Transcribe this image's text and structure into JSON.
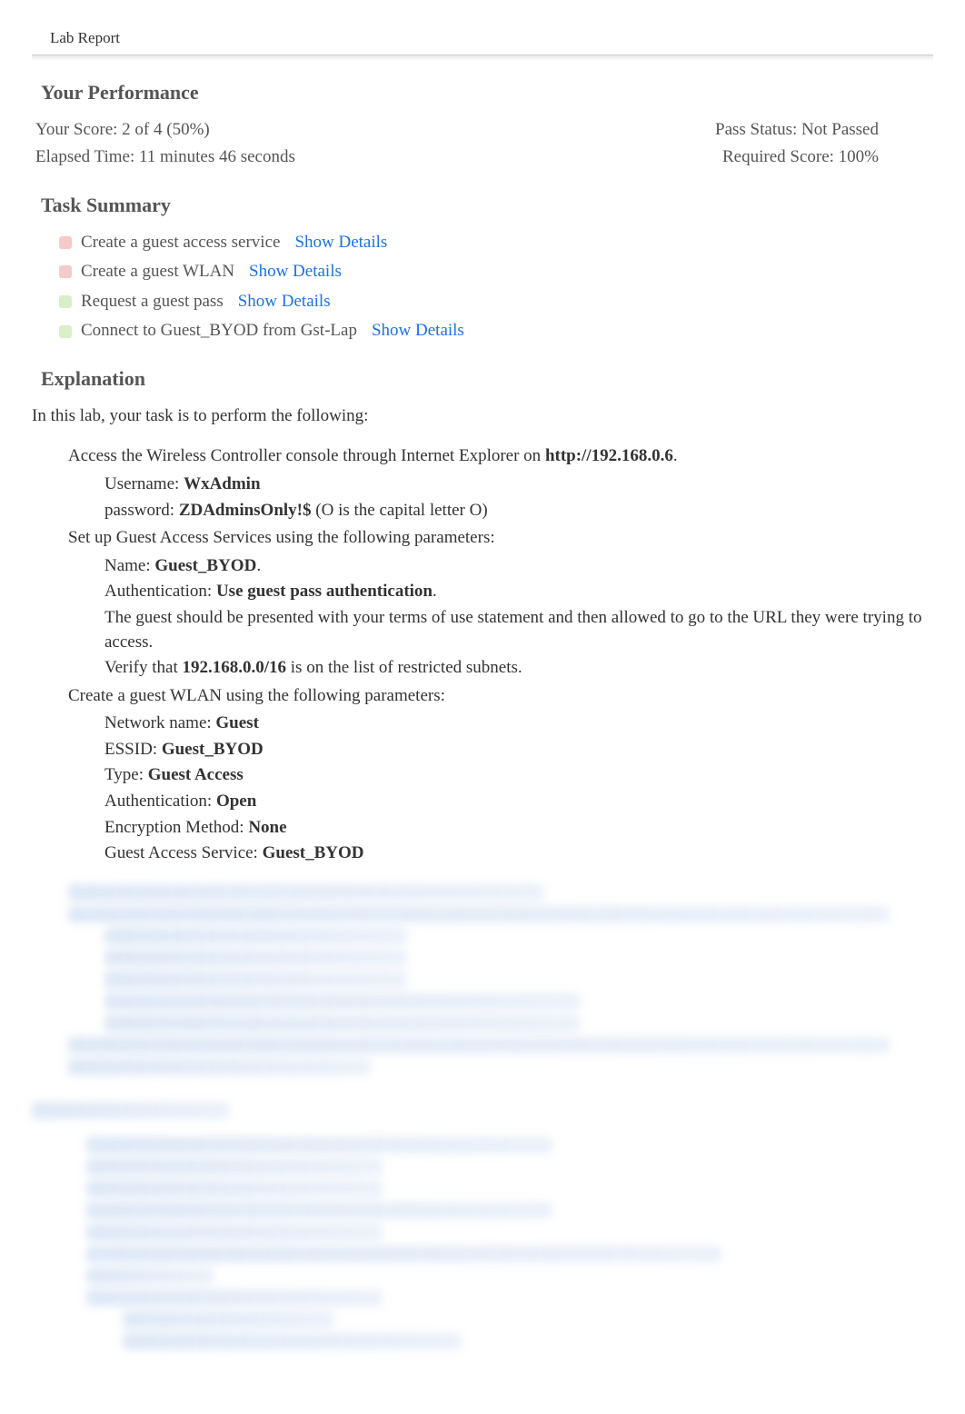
{
  "doc_title": "Lab Report",
  "performance": {
    "heading": "Your Performance",
    "score_label": "Your Score: 2 of 4 (50%)",
    "pass_status": "Pass Status: Not Passed",
    "elapsed_time": "Elapsed Time: 11 minutes 46 seconds",
    "required_score": "Required Score: 100%"
  },
  "task_summary": {
    "heading": "Task Summary",
    "show_details": "Show Details",
    "items": [
      {
        "label": "Create a guest access service",
        "status": "fail"
      },
      {
        "label": "Create a guest WLAN",
        "status": "fail"
      },
      {
        "label": "Request a guest pass",
        "status": "pass"
      },
      {
        "label": "Connect to Guest_BYOD from Gst-Lap",
        "status": "pass"
      }
    ]
  },
  "explanation": {
    "heading": "Explanation",
    "intro": "In this lab, your task is to perform the following:",
    "step1": {
      "prefix": "Access the Wireless Controller console through Internet Explorer on ",
      "url": "http://192.168.0.6",
      "suffix": ".",
      "username_label": "Username: ",
      "username_value": "WxAdmin",
      "password_label": "password: ",
      "password_value": "ZDAdminsOnly!$",
      "password_note": " (O is the capital letter O)"
    },
    "step2": {
      "intro": "Set up Guest Access Services using the following parameters:",
      "name_label": "Name: ",
      "name_value": "Guest_BYOD",
      "name_suffix": ".",
      "auth_label": "Authentication: ",
      "auth_value": "Use guest pass authentication",
      "auth_suffix": ".",
      "terms": "The guest should be presented with your terms of use statement and then allowed to go to the URL they were trying to access.",
      "verify_prefix": "Verify that ",
      "verify_subnet": "192.168.0.0/16",
      "verify_suffix": " is on the list of restricted subnets."
    },
    "step3": {
      "intro": "Create a guest WLAN using the following parameters:",
      "network_label": "Network name: ",
      "network_value": "Guest",
      "essid_label": "ESSID: ",
      "essid_value": "Guest_BYOD",
      "type_label": "Type: ",
      "type_value": "Guest Access",
      "auth_label": "Authentication: ",
      "auth_value": "Open",
      "enc_label": "Encryption Method: ",
      "enc_value": "None",
      "gas_label": "Guest Access Service: ",
      "gas_value": "Guest_BYOD"
    }
  }
}
